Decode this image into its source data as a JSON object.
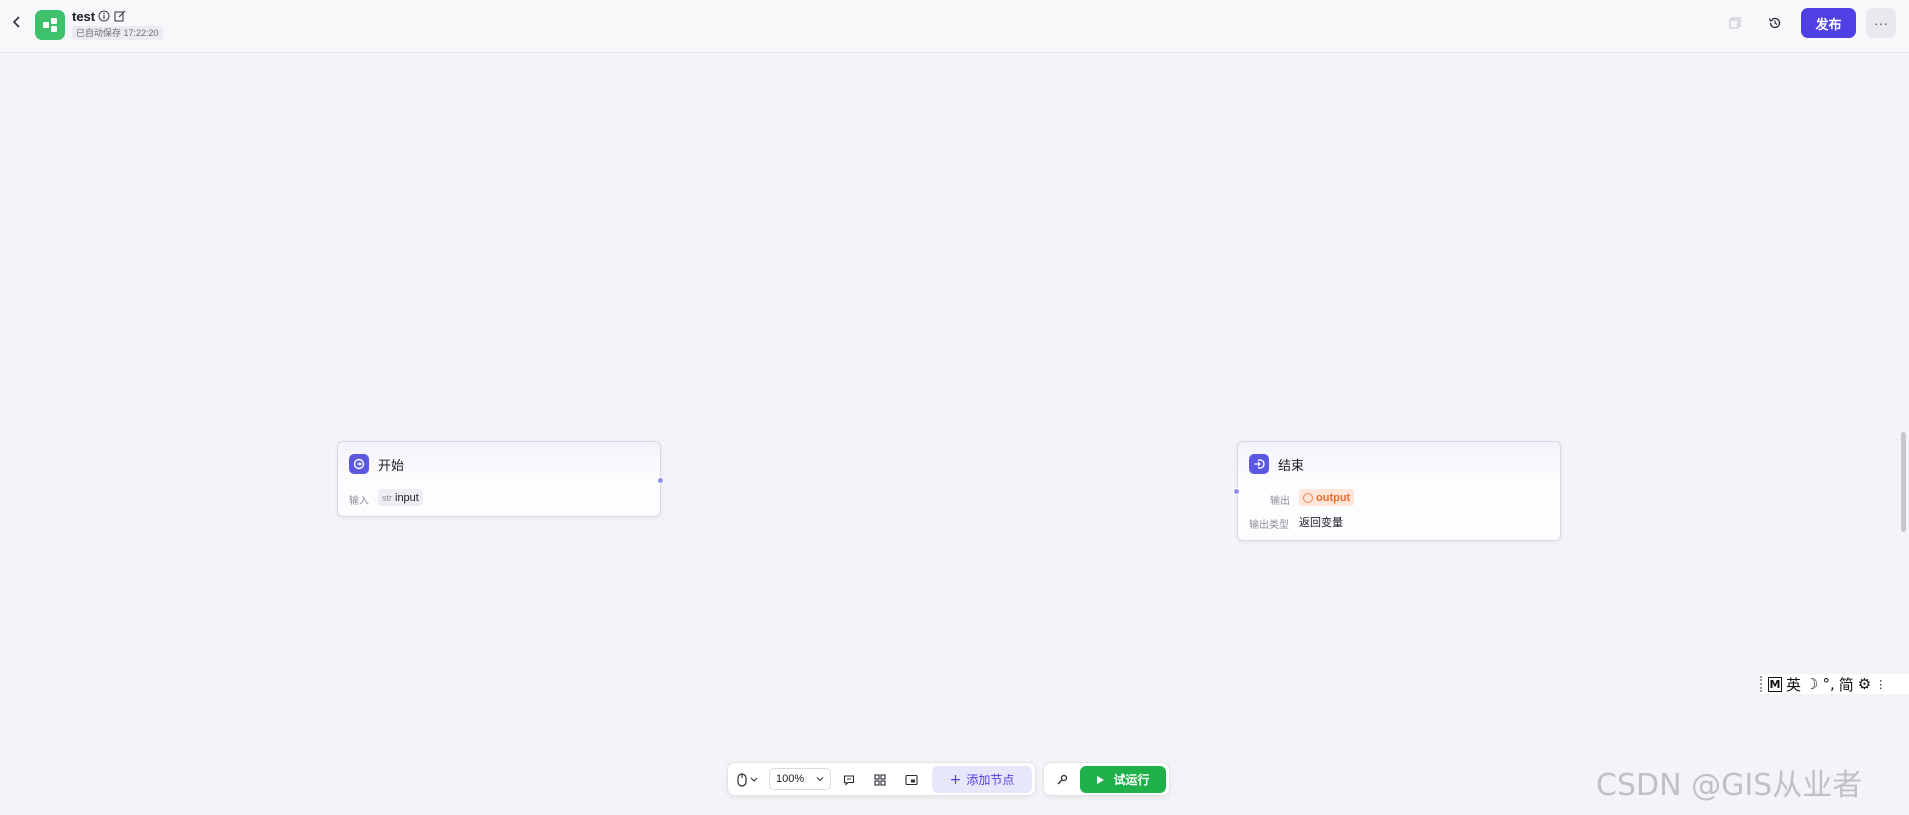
{
  "header": {
    "title": "test",
    "autosave": "已自动保存 17:22:20",
    "publish_label": "发布",
    "more_label": "···"
  },
  "nodes": {
    "start": {
      "title": "开始",
      "input_label": "输入",
      "input_var_type": "str",
      "input_var_name": "input"
    },
    "end": {
      "title": "结束",
      "output_label": "输出",
      "output_var_name": "output",
      "output_type_label": "输出类型",
      "output_type_value": "返回变量"
    }
  },
  "toolbar": {
    "zoom": "100%",
    "add_node_label": "添加节点",
    "run_label": "试运行"
  },
  "ime": {
    "lang": "英",
    "mode": "简"
  },
  "watermark": "CSDN @GIS从业者",
  "colors": {
    "primary": "#4e40e5",
    "run": "#20b04a",
    "logo": "#3ec26b",
    "output_tag": "#e76d33"
  }
}
